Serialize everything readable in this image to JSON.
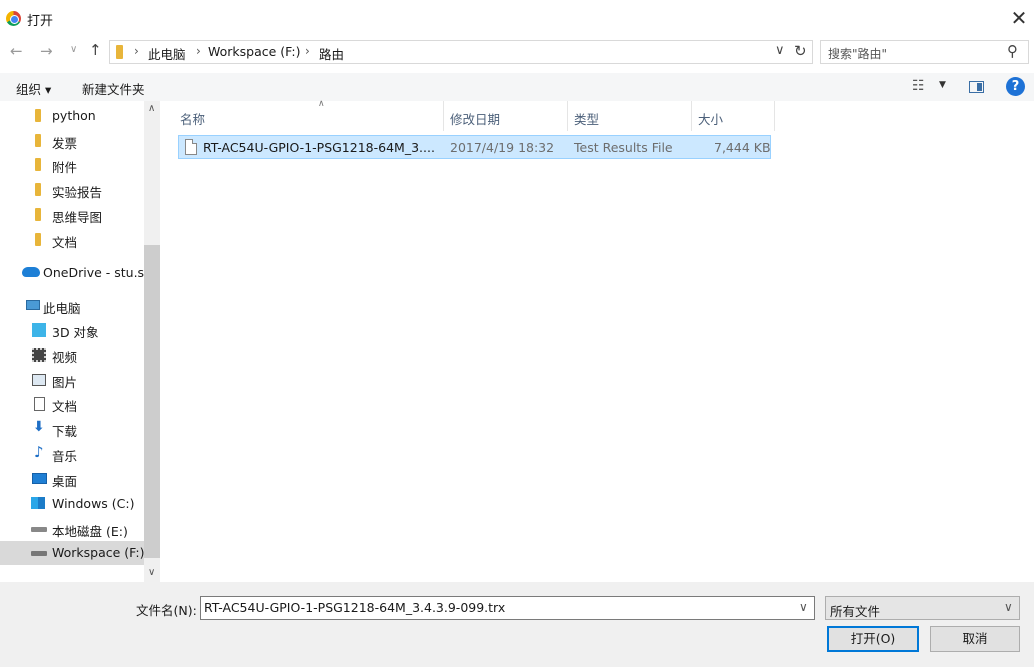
{
  "window": {
    "title": "打开",
    "close_glyph": "✕"
  },
  "nav": {
    "back": "←",
    "forward": "→",
    "recent": "∨",
    "up": "↑",
    "breadcrumb": [
      "此电脑",
      "Workspace (F:)",
      "路由"
    ],
    "separator": "›",
    "dropdown": "∨",
    "refresh": "↻",
    "search_placeholder": "搜索\"路由\""
  },
  "toolbar": {
    "organize": "组织 ▾",
    "new_folder": "新建文件夹",
    "view_glyph": "☷",
    "view_drop": "▼",
    "help": "?"
  },
  "sidebar": {
    "items": [
      {
        "label": "python",
        "icon": "folder-icon"
      },
      {
        "label": "发票",
        "icon": "folder-icon"
      },
      {
        "label": "附件",
        "icon": "folder-icon"
      },
      {
        "label": "实验报告",
        "icon": "folder-icon"
      },
      {
        "label": "思维导图",
        "icon": "folder-icon"
      },
      {
        "label": "文档",
        "icon": "folder-icon"
      },
      {
        "label": "OneDrive - stu.sc",
        "icon": "cloud-icon"
      },
      {
        "label": "此电脑",
        "icon": "computer-icon"
      },
      {
        "label": "3D 对象",
        "icon": "cube-icon"
      },
      {
        "label": "视频",
        "icon": "video-icon"
      },
      {
        "label": "图片",
        "icon": "picture-icon"
      },
      {
        "label": "文档",
        "icon": "document-icon"
      },
      {
        "label": "下载",
        "icon": "download-icon"
      },
      {
        "label": "音乐",
        "icon": "music-icon"
      },
      {
        "label": "桌面",
        "icon": "desktop-icon"
      },
      {
        "label": "Windows (C:)",
        "icon": "windows-drive-icon"
      },
      {
        "label": "本地磁盘 (E:)",
        "icon": "drive-icon"
      },
      {
        "label": "Workspace (F:)",
        "icon": "drive-icon",
        "selected": true
      }
    ],
    "scroll_up": "∧",
    "scroll_down": "∨"
  },
  "file_list": {
    "columns": [
      "名称",
      "修改日期",
      "类型",
      "大小"
    ],
    "sort_indicator": "∧",
    "rows": [
      {
        "name": "RT-AC54U-GPIO-1-PSG1218-64M_3....",
        "modified": "2017/4/19 18:32",
        "type": "Test Results File",
        "size": "7,444 KB",
        "selected": true
      }
    ]
  },
  "bottom": {
    "filename_label": "文件名(N):",
    "filename_value": "RT-AC54U-GPIO-1-PSG1218-64M_3.4.3.9-099.trx",
    "dropdown": "∨",
    "filter_value": "所有文件",
    "open_button": "打开(O)",
    "cancel_button": "取消"
  },
  "colors": {
    "accent": "#0078d7",
    "selection": "#cce8ff",
    "folder": "#e8b53a",
    "help": "#1e72d6"
  }
}
